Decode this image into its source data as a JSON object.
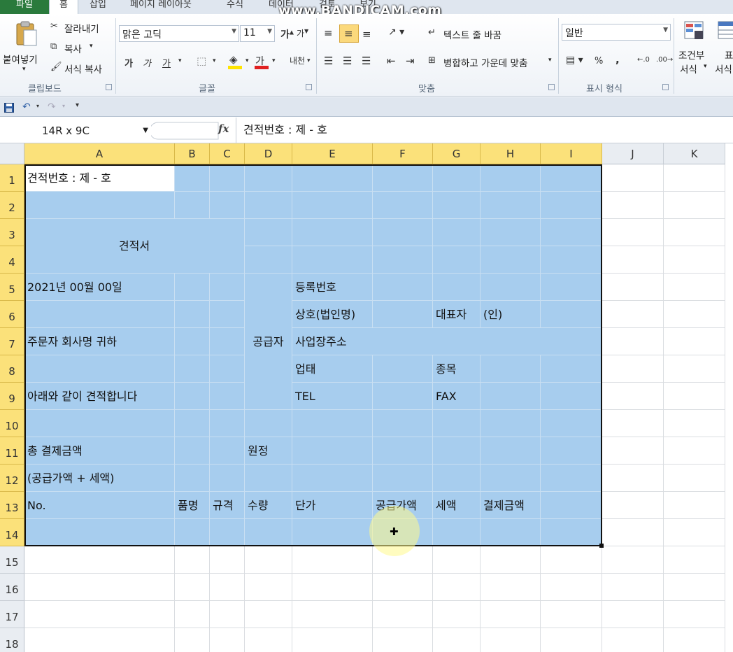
{
  "ribbon_tabs": [
    "파일",
    "홈",
    "삽입",
    "페이지 레이아웃",
    "수식",
    "데이터",
    "검토",
    "보기"
  ],
  "watermark": "www.BANDICAM.com",
  "clipboard": {
    "paste": "붙여넣기",
    "cut": "잘라내기",
    "copy": "복사",
    "format_painter": "서식 복사",
    "label": "클립보드"
  },
  "font": {
    "name": "맑은 고딕",
    "size": "11",
    "label": "글꼴",
    "bold": "가",
    "italic": "가",
    "underline": "가",
    "font_color": "가",
    "phonetic": "내천"
  },
  "alignment": {
    "wrap_text": "텍스트 줄 바꿈",
    "merge_center": "병합하고 가운데 맞춤",
    "label": "맞춤"
  },
  "number": {
    "format": "일반",
    "label": "표시 형식",
    "percent": "%",
    "comma": ","
  },
  "styles": {
    "conditional_1": "조건부",
    "conditional_2": "서식",
    "table_1": "표",
    "table_2": "서식"
  },
  "formula_bar": {
    "name_box": "14R x 9C",
    "fx": "fx",
    "content": "견적번호 : 제  -  호"
  },
  "columns": [
    "A",
    "B",
    "C",
    "D",
    "E",
    "F",
    "G",
    "H",
    "I",
    "J",
    "K"
  ],
  "rows": [
    "1",
    "2",
    "3",
    "4",
    "5",
    "6",
    "7",
    "8",
    "9",
    "10",
    "11",
    "12",
    "13",
    "14",
    "15",
    "16",
    "17",
    "18"
  ],
  "cells": {
    "A1": "견적번호 : 제  -  호",
    "A3": "견적서",
    "A5": "2021년    00월    00일",
    "A7": "주문자 회사명     귀하",
    "A9": "아래와 같이 견적합니다",
    "A11": "총 결제금액",
    "A12": "(공급가액 + 세액)",
    "A13": "No.",
    "B13": "품명",
    "C13": "규격",
    "D13": "수량",
    "E13": "단가",
    "F13": "공급가액",
    "G13": "세액",
    "H13": "결제금액",
    "D7": "공급자",
    "D11": "원정",
    "E5": "등록번호",
    "E6": "상호(법인명)",
    "G6": "대표자",
    "H6": "(인)",
    "E7": "사업장주소",
    "E8": "업태",
    "G8": "종목",
    "E9": "TEL",
    "G9": "FAX"
  },
  "colors": {
    "selection": "#a7cdee",
    "header_highlight": "#fbe17a",
    "file_tab": "#2a7a3c",
    "font_color_bar": "#e02020",
    "fill_color_bar": "#ffe400"
  }
}
